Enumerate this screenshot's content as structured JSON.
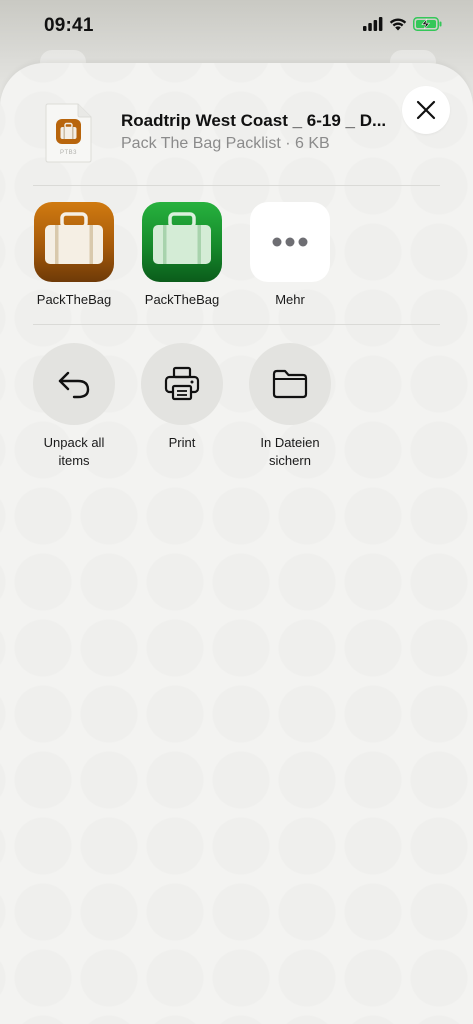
{
  "status_bar": {
    "time": "09:41"
  },
  "header": {
    "file_type_label": "PTB3",
    "title": "Roadtrip West Coast _ 6-19 _ D...",
    "subtitle": "Pack The Bag Packlist · 6 KB"
  },
  "apps": [
    {
      "label": "PackTheBag",
      "icon": "suitcase-icon",
      "color": "#b8650c"
    },
    {
      "label": "PackTheBag",
      "icon": "suitcase-icon",
      "color": "#1f9a35"
    },
    {
      "label": "Mehr",
      "icon": "more-icon"
    }
  ],
  "actions": [
    {
      "label_line1": "Unpack all",
      "label_line2": "items",
      "icon": "undo-arrow-icon"
    },
    {
      "label_line1": "Print",
      "icon": "printer-icon"
    },
    {
      "label_line1": "In Dateien",
      "label_line2": "sichern",
      "icon": "folder-icon"
    }
  ],
  "colors": {
    "sheet_bg": "#f3f3f1",
    "action_bg": "#e3e3e0",
    "battery_green": "#34c759"
  }
}
